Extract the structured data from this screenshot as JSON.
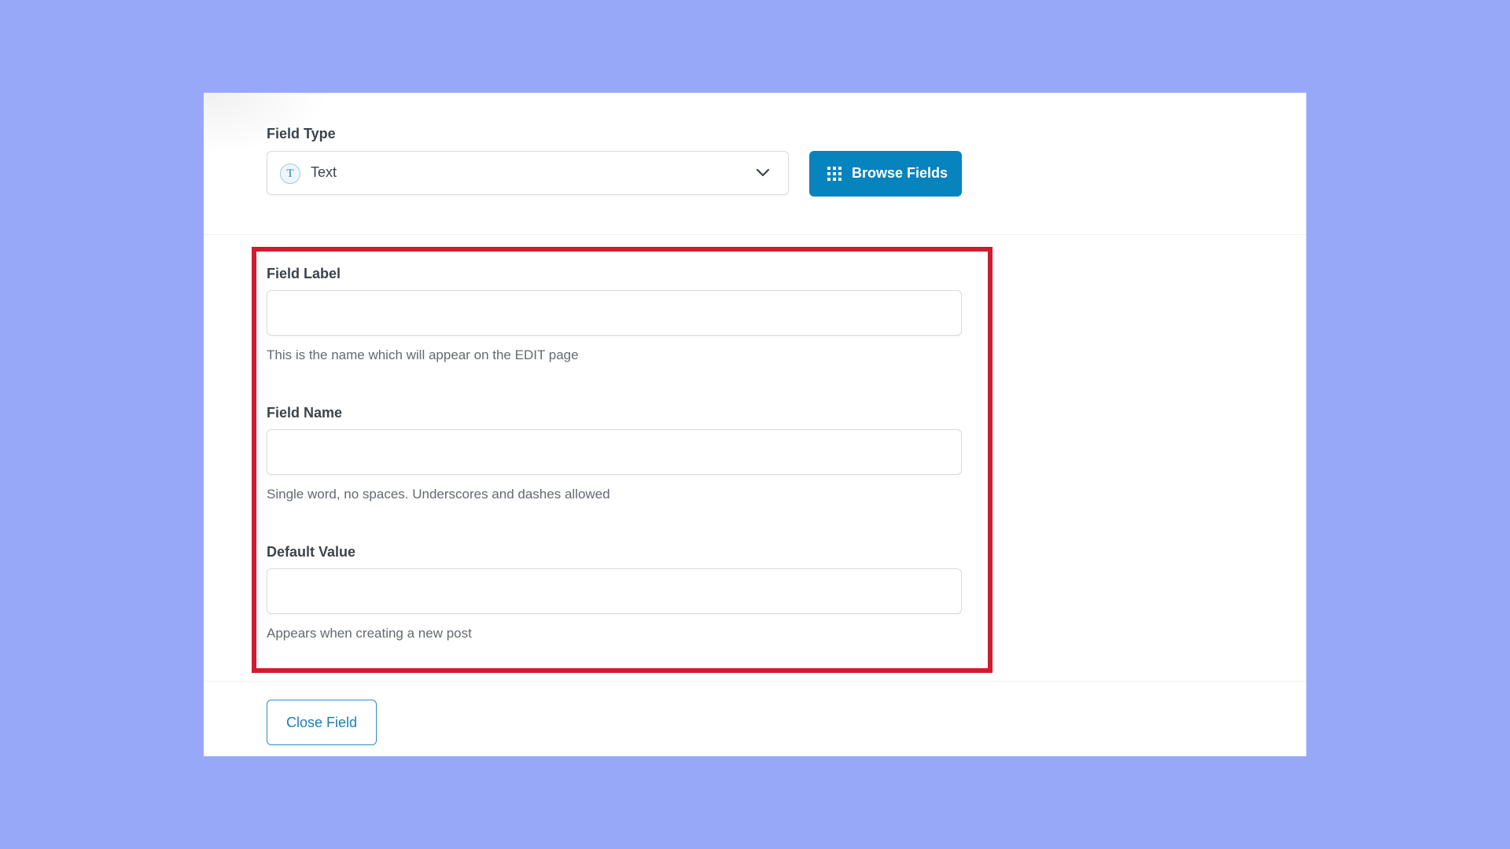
{
  "field_type": {
    "label": "Field Type",
    "selected": "Text",
    "type_icon_glyph": "T",
    "type_icon": "text-type-icon",
    "dropdown_icon": "chevron-down-icon"
  },
  "browse_button": {
    "label": "Browse Fields",
    "icon": "grid-icon",
    "color": "#0783be"
  },
  "fields": [
    {
      "label": "Field Label",
      "value": "",
      "help": "This is the name which will appear on the EDIT page"
    },
    {
      "label": "Field Name",
      "value": "",
      "help": "Single word, no spaces. Underscores and dashes allowed"
    },
    {
      "label": "Default Value",
      "value": "",
      "help": "Appears when creating a new post"
    }
  ],
  "close_button": {
    "label": "Close Field"
  },
  "colors": {
    "background": "#98a8f8",
    "highlight": "#d01c2f",
    "accent": "#0783be"
  }
}
